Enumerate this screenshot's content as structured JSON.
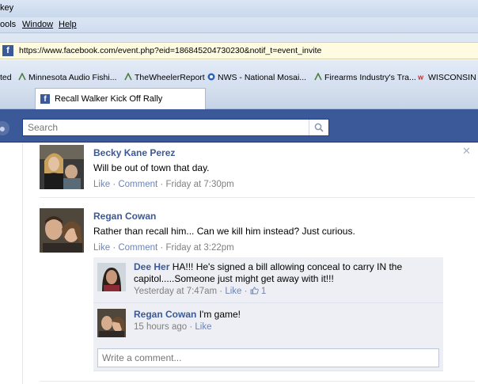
{
  "window": {
    "title_fragment": "key"
  },
  "menu": {
    "tools": "ools",
    "window": "Window",
    "help": "Help"
  },
  "address": {
    "url": "https://www.facebook.com/event.php?eid=186845204730230&notif_t=event_invite"
  },
  "bookmarks": [
    {
      "label": "ted",
      "icon": "none"
    },
    {
      "label": "Minnesota Audio Fishi...",
      "icon": "bookmark-icon"
    },
    {
      "label": "TheWheelerReport",
      "icon": "bookmark-icon"
    },
    {
      "label": "NWS - National Mosai...",
      "icon": "nws-icon"
    },
    {
      "label": "Firearms Industry's Tra...",
      "icon": "bookmark-icon"
    },
    {
      "label": "WISCONSIN",
      "icon": "wh-icon"
    }
  ],
  "tab": {
    "label": "Recall Walker Kick Off Rally"
  },
  "search": {
    "placeholder": "Search"
  },
  "posts": [
    {
      "name": "Becky Kane Perez",
      "text": "Will be out of town that day.",
      "like": "Like",
      "comment": "Comment",
      "time": "Friday at 7:30pm"
    },
    {
      "name": "Regan Cowan",
      "text": "Rather than recall him... Can we kill him instead? Just curious.",
      "like": "Like",
      "comment": "Comment",
      "time": "Friday at 3:22pm"
    }
  ],
  "replies": [
    {
      "name": "Dee Her",
      "text": "HA!!! He's signed a bill allowing conceal to carry IN the capitol.....Someone just might get away with it!!!",
      "time": "Yesterday at 7:47am",
      "like": "Like",
      "likes_count": "1"
    },
    {
      "name": "Regan Cowan",
      "text": "I'm game!",
      "time": "15 hours ago",
      "like": "Like"
    }
  ],
  "write_comment": {
    "placeholder": "Write a comment..."
  },
  "separators": {
    "dot": "·"
  },
  "colors": {
    "facebook_blue": "#3b5998",
    "link": "#6d84b4",
    "reply_bg": "#edeff4"
  }
}
